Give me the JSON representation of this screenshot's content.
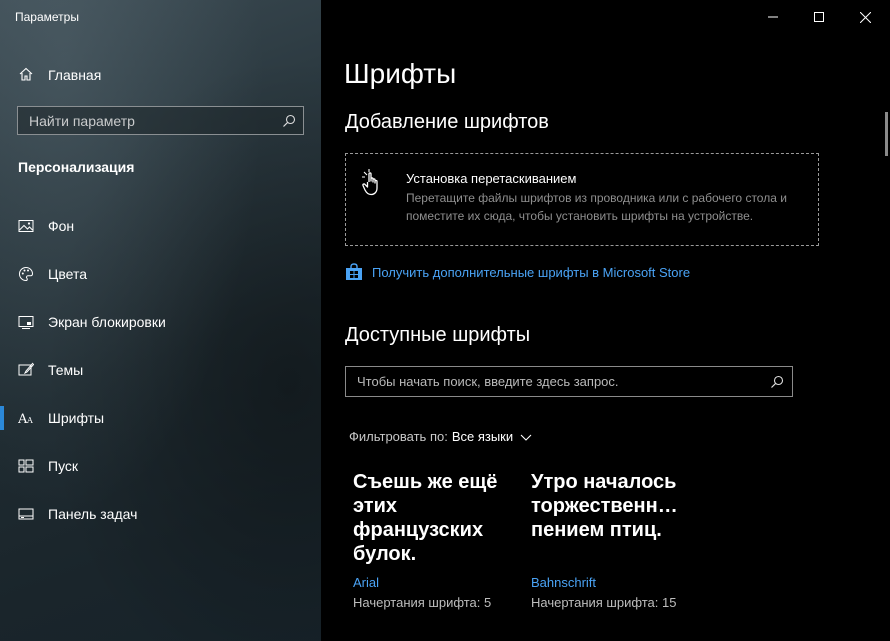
{
  "window": {
    "title": "Параметры",
    "minimize_icon": "minimize-icon",
    "maximize_icon": "maximize-icon",
    "close_icon": "close-icon"
  },
  "sidebar": {
    "home": {
      "label": "Главная",
      "icon": "home-icon"
    },
    "search": {
      "placeholder": "Найти параметр",
      "icon": "search-icon"
    },
    "section_title": "Персонализация",
    "items": [
      {
        "label": "Фон",
        "icon": "image-icon",
        "active": false
      },
      {
        "label": "Цвета",
        "icon": "palette-icon",
        "active": false
      },
      {
        "label": "Экран блокировки",
        "icon": "lock-screen-icon",
        "active": false
      },
      {
        "label": "Темы",
        "icon": "brush-icon",
        "active": false
      },
      {
        "label": "Шрифты",
        "icon": "font-icon",
        "active": true
      },
      {
        "label": "Пуск",
        "icon": "start-icon",
        "active": false
      },
      {
        "label": "Панель задач",
        "icon": "taskbar-icon",
        "active": false
      }
    ],
    "accent_color": "#2b88d8"
  },
  "main": {
    "page_title": "Шрифты",
    "add_section_title": "Добавление шрифтов",
    "dropzone": {
      "title": "Установка перетаскиванием",
      "description": "Перетащите файлы шрифтов из проводника или с рабочего стола и поместите их сюда, чтобы установить шрифты на устройстве.",
      "icon": "drag-hand-icon"
    },
    "store_link": {
      "label": "Получить дополнительные шрифты в Microsoft Store",
      "icon": "store-icon"
    },
    "available_section_title": "Доступные шрифты",
    "font_search": {
      "placeholder": "Чтобы начать поиск, введите здесь запрос.",
      "icon": "search-icon"
    },
    "filter": {
      "label": "Фильтровать по:",
      "value": "Все языки",
      "icon": "chevron-down-icon"
    },
    "fonts": [
      {
        "preview": "Съешь же ещё этих французских булок.",
        "name": "Arial",
        "styles": "Начертания шрифта: 5"
      },
      {
        "preview": "Утро началось торжественн… пением птиц.",
        "name": "Bahnschrift",
        "styles": "Начертания шрифта: 15"
      }
    ],
    "link_color": "#4aa3f5"
  }
}
